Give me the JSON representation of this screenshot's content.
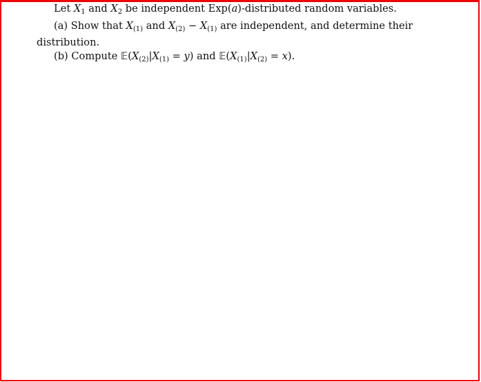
{
  "problem": {
    "line1": {
      "prefix": "Let ",
      "X": "X",
      "sub1": "1",
      "and": " and ",
      "sub2": "2",
      "rest": " be independent Exp(",
      "param": "a",
      "end": ")-distributed random variables."
    },
    "line2": {
      "prefix": "(a) Show that ",
      "X": "X",
      "sub1": "(1)",
      "and": " and ",
      "sub2": "(2)",
      "minus": " − ",
      "sub3": "(1)",
      "rest": " are independent, and determine their"
    },
    "line3": {
      "text": "distribution."
    },
    "line4": {
      "prefix": "(b) Compute ",
      "E": "𝔼",
      "open": "(",
      "X": "X",
      "sub_a": "(2)",
      "bar": "|",
      "sub_b": "(1)",
      "eq": " = ",
      "var_y": "y",
      "close_and": ") and ",
      "sub_c": "(1)",
      "sub_d": "(2)",
      "var_x": "x",
      "end": ")."
    }
  },
  "colors": {
    "border": "#ee0000",
    "text": "#111111",
    "background": "#ffffff"
  }
}
